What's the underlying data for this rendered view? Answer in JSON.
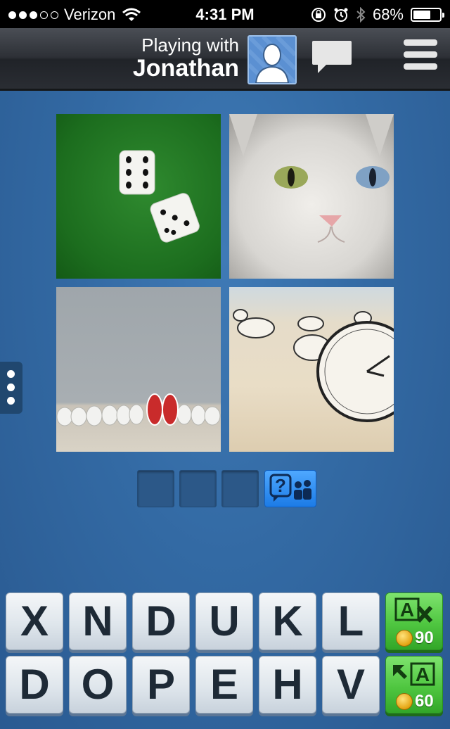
{
  "status_bar": {
    "carrier": "Verizon",
    "signal_bars_filled": 3,
    "signal_bars_total": 5,
    "time": "4:31 PM",
    "battery_percent_label": "68%",
    "battery_level": 0.68
  },
  "header": {
    "playing_with_label": "Playing with",
    "opponent_name": "Jonathan",
    "avatar_icon": "person-avatar-icon",
    "chat_icon": "chat-bubble-icon",
    "menu_icon": "hamburger-menu-icon"
  },
  "puzzle": {
    "images": [
      {
        "name": "dice-on-green-felt"
      },
      {
        "name": "white-cat-odd-eyes"
      },
      {
        "name": "red-sneakers-among-white-sneakers"
      },
      {
        "name": "clocks-in-sand"
      }
    ],
    "answer_slots": [
      "",
      "",
      ""
    ],
    "help_button_icon": "ask-friends-icon"
  },
  "keyboard": {
    "row1": [
      "X",
      "N",
      "D",
      "U",
      "K",
      "L"
    ],
    "row2": [
      "D",
      "O",
      "P",
      "E",
      "H",
      "V"
    ],
    "remove_letters": {
      "icon": "remove-letters-icon",
      "cost": "90"
    },
    "reveal_letter": {
      "icon": "reveal-letter-icon",
      "cost": "60"
    }
  },
  "colors": {
    "background": "#336aa4",
    "tile_shadow": "#5d7796",
    "powerup_green": "#4fc640",
    "help_blue": "#1c7be6"
  }
}
